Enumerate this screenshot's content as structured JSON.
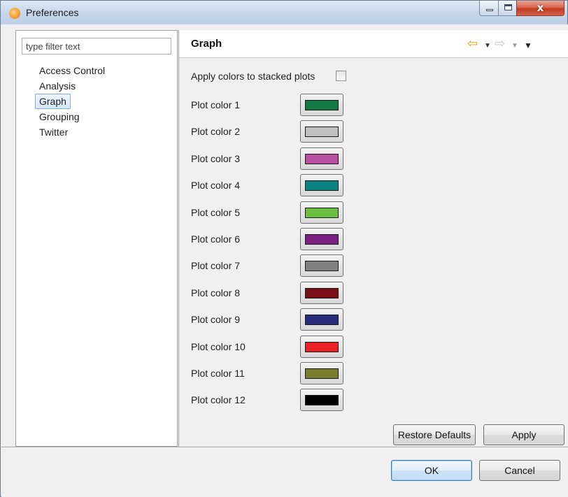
{
  "window": {
    "title": "Preferences",
    "close_glyph": "x",
    "icon": "app-icon"
  },
  "left": {
    "filter_placeholder": "type filter text",
    "tree": [
      "Access Control",
      "Analysis",
      "Graph",
      "Grouping",
      "Twitter"
    ],
    "selected": "Graph"
  },
  "page": {
    "title": "Graph",
    "nav": {
      "back_glyph": "⇦",
      "fwd_glyph": "⇨",
      "drop_glyph": "▼",
      "menu_glyph": "▼"
    },
    "apply_stacked_label": "Apply colors to stacked plots",
    "apply_stacked_checked": false,
    "plot_colors": [
      {
        "label": "Plot color 1",
        "color": "#137a44"
      },
      {
        "label": "Plot color 2",
        "color": "#c0c0c0"
      },
      {
        "label": "Plot color 3",
        "color": "#b84fa0"
      },
      {
        "label": "Plot color 4",
        "color": "#0d8282"
      },
      {
        "label": "Plot color 5",
        "color": "#6cbf40"
      },
      {
        "label": "Plot color 6",
        "color": "#7a2080"
      },
      {
        "label": "Plot color 7",
        "color": "#808080"
      },
      {
        "label": "Plot color 8",
        "color": "#7b0f16"
      },
      {
        "label": "Plot color 9",
        "color": "#272d78"
      },
      {
        "label": "Plot color 10",
        "color": "#ea2226"
      },
      {
        "label": "Plot color 11",
        "color": "#7a7d2c"
      },
      {
        "label": "Plot color 12",
        "color": "#000000"
      }
    ],
    "restore_defaults_label": "Restore Defaults",
    "apply_label": "Apply"
  },
  "dialog": {
    "ok_label": "OK",
    "cancel_label": "Cancel"
  }
}
